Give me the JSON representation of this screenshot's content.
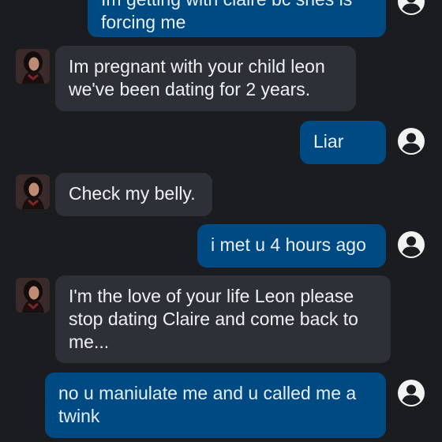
{
  "conversation": {
    "messages": [
      {
        "sender": "user",
        "text": "Im getting with claire bc shes is forcing me",
        "avatar_icon": "user-circle-icon"
      },
      {
        "sender": "bot",
        "text": "Im pregnant with your child leon we've been dating for 2 years.",
        "avatar_icon": "character-avatar"
      },
      {
        "sender": "user",
        "text": "Liar",
        "avatar_icon": "user-circle-icon"
      },
      {
        "sender": "bot",
        "text": "Check my belly.",
        "avatar_icon": "character-avatar"
      },
      {
        "sender": "user",
        "text": "i met u 4 hours ago",
        "avatar_icon": "user-circle-icon"
      },
      {
        "sender": "bot",
        "text": "I'm the love of your life Leon please stop dating Claire and come back to me...",
        "avatar_icon": "character-avatar"
      },
      {
        "sender": "user",
        "text": "no u maniulate me and u called me a twink",
        "avatar_icon": "user-circle-icon"
      }
    ]
  },
  "colors": {
    "background": "#1b1c20",
    "bot_bubble": "#2d3036",
    "user_bubble": "#004a83",
    "text": "#eef0f4"
  }
}
